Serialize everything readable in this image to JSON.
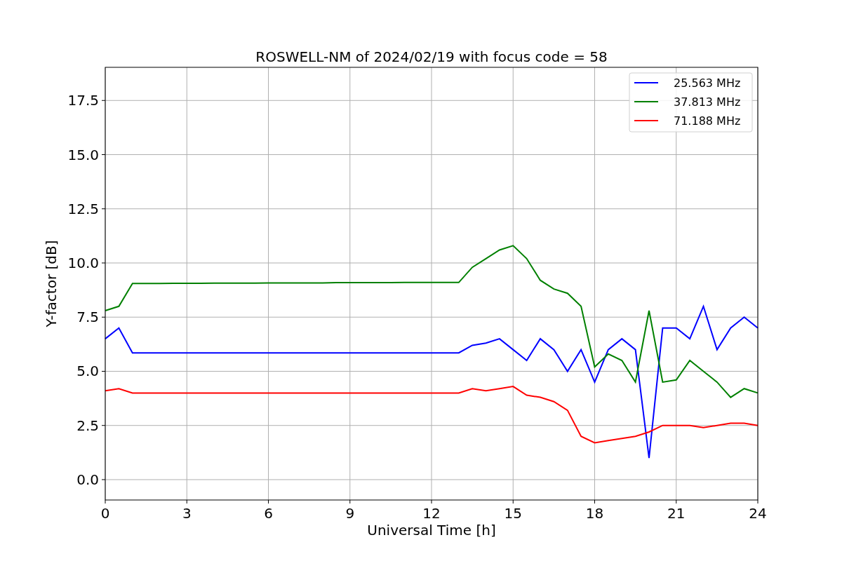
{
  "figure": {
    "chart_data": {
      "type": "line",
      "title": "ROSWELL-NM of 2024/02/19 with focus code = 58",
      "xlabel": "Universal Time [h]",
      "ylabel": "Y-factor [dB]",
      "x": [
        0,
        0.5,
        1,
        1.5,
        2,
        2.5,
        3,
        3.5,
        4,
        4.5,
        5,
        5.5,
        6,
        6.5,
        7,
        7.5,
        8,
        8.5,
        9,
        9.5,
        10,
        10.5,
        11,
        11.5,
        12,
        12.5,
        13,
        13.5,
        14,
        14.5,
        15,
        15.5,
        16,
        16.5,
        17,
        17.5,
        18,
        18.5,
        19,
        19.5,
        20,
        20.5,
        21,
        21.5,
        22,
        22.5,
        23,
        23.5,
        24
      ],
      "series": [
        {
          "name": "25.563 MHz",
          "color": "#0000ff",
          "values": [
            6.5,
            7,
            5.85,
            5.85,
            5.85,
            5.85,
            5.85,
            5.85,
            5.85,
            5.85,
            5.85,
            5.85,
            5.85,
            5.85,
            5.85,
            5.85,
            5.85,
            5.85,
            5.85,
            5.85,
            5.85,
            5.85,
            5.85,
            5.85,
            5.85,
            5.85,
            5.85,
            6.2,
            6.3,
            6.5,
            6,
            5.5,
            6.5,
            6,
            5,
            6,
            4.5,
            6,
            6.5,
            6,
            1,
            7,
            7,
            6.5,
            8,
            6,
            7,
            7.5,
            7
          ]
        },
        {
          "name": "37.813 MHz",
          "color": "#008000",
          "values": [
            7.8,
            8,
            9.05,
            9.05,
            9.05,
            9.06,
            9.06,
            9.06,
            9.07,
            9.07,
            9.07,
            9.07,
            9.08,
            9.08,
            9.08,
            9.08,
            9.08,
            9.09,
            9.09,
            9.09,
            9.09,
            9.09,
            9.1,
            9.1,
            9.1,
            9.1,
            9.1,
            9.8,
            10.2,
            10.6,
            10.8,
            10.2,
            9.2,
            8.8,
            8.6,
            8,
            5.2,
            5.8,
            5.5,
            4.5,
            7.8,
            4.5,
            4.6,
            5.5,
            5,
            4.5,
            3.8,
            4.2,
            4
          ]
        },
        {
          "name": "71.188 MHz",
          "color": "#ff0000",
          "values": [
            4.1,
            4.2,
            4,
            4,
            4,
            4,
            4,
            4,
            4,
            4,
            4,
            4,
            4,
            4,
            4,
            4,
            4,
            4,
            4,
            4,
            4,
            4,
            4,
            4,
            4,
            4,
            4,
            4.2,
            4.1,
            4.2,
            4.3,
            3.9,
            3.8,
            3.6,
            3.2,
            2,
            1.7,
            1.8,
            1.9,
            2,
            2.2,
            2.5,
            2.5,
            2.5,
            2.4,
            2.5,
            2.6,
            2.6,
            2.5
          ]
        }
      ],
      "grid": true,
      "legend": true,
      "xlim": [
        0,
        24
      ],
      "ylim": [
        -0.94,
        19.03
      ],
      "xticks": [
        0,
        3,
        6,
        9,
        12,
        15,
        18,
        21,
        24
      ],
      "yticks": [
        {
          "value": 0,
          "label": "0.0"
        },
        {
          "value": 2.5,
          "label": "2.5"
        },
        {
          "value": 5,
          "label": "5.0"
        },
        {
          "value": 7.5,
          "label": "7.5"
        },
        {
          "value": 10,
          "label": "10.0"
        },
        {
          "value": 12.5,
          "label": "12.5"
        },
        {
          "value": 15,
          "label": "15.0"
        },
        {
          "value": 17.5,
          "label": "17.5"
        }
      ]
    }
  }
}
